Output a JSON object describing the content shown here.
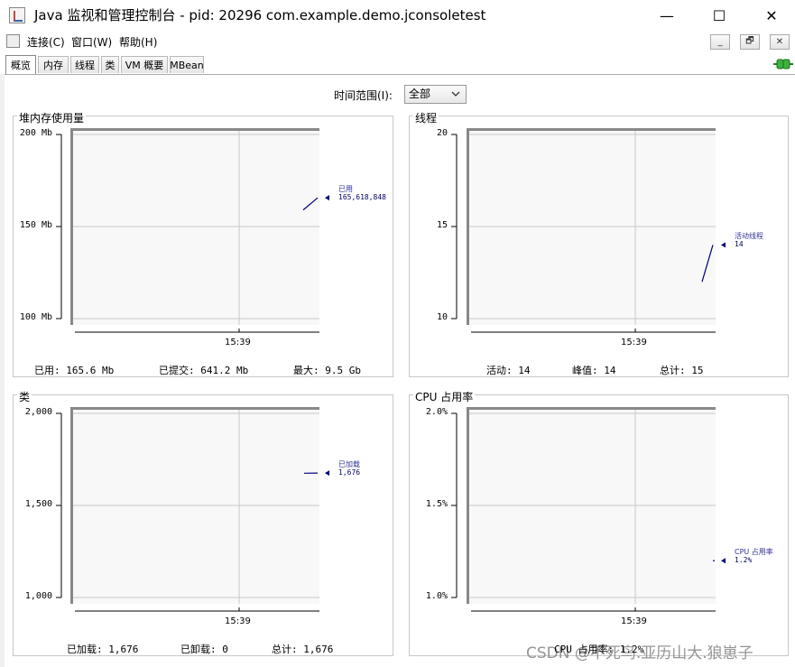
{
  "window": {
    "title": "Java 监视和管理控制台 - pid: 20296 com.example.demo.jconsoletest",
    "minimize": "—",
    "maximize": "☐",
    "close": "✕"
  },
  "menu": {
    "items": [
      "连接(C)",
      "窗口(W)",
      "帮助(H)"
    ],
    "mdi_buttons": [
      "_",
      "🗗",
      "✕"
    ]
  },
  "tabs": [
    "概览",
    "内存",
    "线程",
    "类",
    "VM 概要",
    "MBean"
  ],
  "active_tab": "概览",
  "time_range": {
    "label": "时间范围(I):",
    "selected": "全部"
  },
  "panels": {
    "heap": {
      "title": "堆内存使用量",
      "y_ticks": [
        "200 Mb",
        "150 Mb",
        "100 Mb"
      ],
      "x_tick": "15:39",
      "legend_name": "已用",
      "legend_value": "165,618,848",
      "stats": [
        {
          "label": "已用:",
          "value": "165.6  Mb"
        },
        {
          "label": "已提交:",
          "value": "641.2  Mb"
        },
        {
          "label": "最大:",
          "value": "9.5  Gb"
        }
      ]
    },
    "threads": {
      "title": "线程",
      "y_ticks": [
        "20",
        "15",
        "10"
      ],
      "x_tick": "15:39",
      "legend_name": "活动线程",
      "legend_value": "14",
      "stats": [
        {
          "label": "活动:",
          "value": "14"
        },
        {
          "label": "峰值:",
          "value": "14"
        },
        {
          "label": "总计:",
          "value": "15"
        }
      ]
    },
    "classes": {
      "title": "类",
      "y_ticks": [
        "2,000",
        "1,500",
        "1,000"
      ],
      "x_tick": "15:39",
      "legend_name": "已加载",
      "legend_value": "1,676",
      "stats": [
        {
          "label": "已加载:",
          "value": "1,676"
        },
        {
          "label": "已卸载:",
          "value": "0"
        },
        {
          "label": "总计:",
          "value": "1,676"
        }
      ]
    },
    "cpu": {
      "title": "CPU 占用率",
      "y_ticks": [
        "2.0%",
        "1.5%",
        "1.0%"
      ],
      "x_tick": "15:39",
      "legend_name": "CPU 占用率",
      "legend_value": "1.2%",
      "stats": [
        {
          "label": "CPU 占用率:",
          "value": "1.2%"
        }
      ]
    }
  },
  "chart_data": [
    {
      "type": "line",
      "title": "堆内存使用量",
      "ylim": [
        100,
        200
      ],
      "unit": "Mb",
      "x": [
        "15:39"
      ],
      "series": [
        {
          "name": "已用",
          "values": [
            159,
            165.6
          ]
        }
      ]
    },
    {
      "type": "line",
      "title": "线程",
      "ylim": [
        10,
        20
      ],
      "x": [
        "15:39"
      ],
      "series": [
        {
          "name": "活动线程",
          "values": [
            12,
            14
          ]
        }
      ]
    },
    {
      "type": "line",
      "title": "类",
      "ylim": [
        1000,
        2000
      ],
      "x": [
        "15:39"
      ],
      "series": [
        {
          "name": "已加载",
          "values": [
            1675,
            1676
          ]
        }
      ]
    },
    {
      "type": "line",
      "title": "CPU 占用率",
      "ylim": [
        1.0,
        2.0
      ],
      "unit": "%",
      "x": [
        "15:39"
      ],
      "series": [
        {
          "name": "CPU 占用率",
          "values": [
            1.2
          ]
        }
      ]
    }
  ],
  "watermark": "CSDN @不死鸟.亚历山大.狼崽子",
  "colors": {
    "series": "#000080",
    "grid": "#c8c8c8",
    "plot_bg": "#f8f8f8"
  }
}
